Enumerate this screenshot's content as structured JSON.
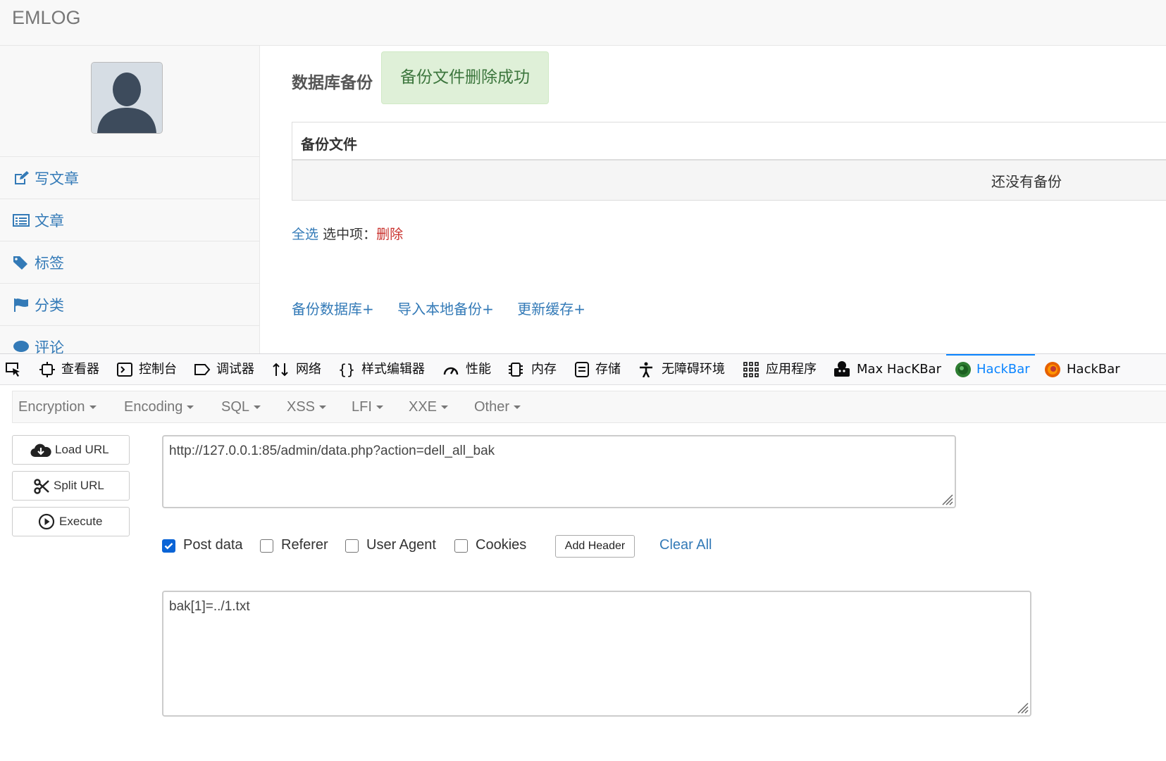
{
  "app": {
    "brand": "EMLOG",
    "sidebar": {
      "items": [
        {
          "label": "写文章",
          "icon": "edit-icon"
        },
        {
          "label": "文章",
          "icon": "list-icon"
        },
        {
          "label": "标签",
          "icon": "tags-icon"
        },
        {
          "label": "分类",
          "icon": "flag-icon"
        },
        {
          "label": "评论",
          "icon": "comment-icon"
        }
      ]
    },
    "main": {
      "title": "数据库备份",
      "alert": "备份文件删除成功",
      "table_header": "备份文件",
      "empty_text": "还没有备份",
      "select_all": "全选",
      "selected_label": "选中项：",
      "delete": "删除",
      "actions": [
        "备份数据库+",
        "导入本地备份+",
        "更新缓存+"
      ]
    }
  },
  "devtools": {
    "tabs": [
      {
        "label": "查看器",
        "icon": "inspector-icon"
      },
      {
        "label": "控制台",
        "icon": "console-icon"
      },
      {
        "label": "调试器",
        "icon": "debugger-icon"
      },
      {
        "label": "网络",
        "icon": "network-icon"
      },
      {
        "label": "样式编辑器",
        "icon": "style-editor-icon"
      },
      {
        "label": "性能",
        "icon": "performance-icon"
      },
      {
        "label": "内存",
        "icon": "memory-icon"
      },
      {
        "label": "存储",
        "icon": "storage-icon"
      },
      {
        "label": "无障碍环境",
        "icon": "accessibility-icon"
      },
      {
        "label": "应用程序",
        "icon": "application-icon"
      },
      {
        "label": "Max HacKBar",
        "icon": "max-hackbar-icon"
      },
      {
        "label": "HackBar",
        "icon": "hackbar-green-icon",
        "active": true
      },
      {
        "label": "HackBar",
        "icon": "hackbar-firefox-icon"
      }
    ],
    "accent": "#0a84ff"
  },
  "hackbar": {
    "menu": [
      "Encryption",
      "Encoding",
      "SQL",
      "XSS",
      "LFI",
      "XXE",
      "Other"
    ],
    "buttons": {
      "load": "Load URL",
      "split": "Split URL",
      "execute": "Execute"
    },
    "url": "http://127.0.0.1:85/admin/data.php?action=dell_all_bak",
    "options": {
      "post_data": {
        "label": "Post data",
        "checked": true
      },
      "referer": {
        "label": "Referer",
        "checked": false
      },
      "user_agent": {
        "label": "User Agent",
        "checked": false
      },
      "cookies": {
        "label": "Cookies",
        "checked": false
      }
    },
    "add_header": "Add Header",
    "clear_all": "Clear All",
    "post_body": "bak[1]=../1.txt"
  }
}
